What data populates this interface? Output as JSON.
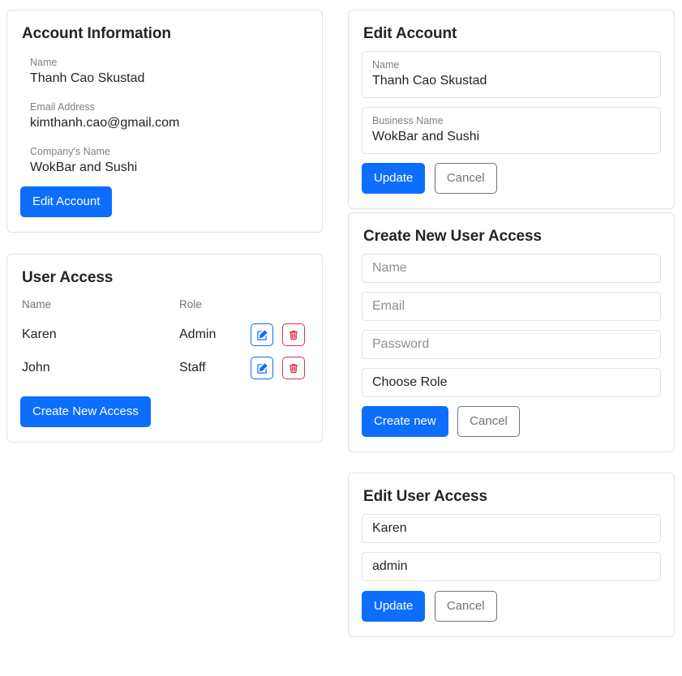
{
  "account_information": {
    "title": "Account Information",
    "fields": [
      {
        "label": "Name",
        "value": "Thanh Cao Skustad"
      },
      {
        "label": "Email Address",
        "value": "kimthanh.cao@gmail.com"
      },
      {
        "label": "Company's Name",
        "value": "WokBar and Sushi"
      }
    ],
    "edit_button": "Edit Account"
  },
  "user_access": {
    "title": "User Access",
    "columns": [
      "Name",
      "Role"
    ],
    "rows": [
      {
        "name": "Karen",
        "role": "Admin",
        "edit_icon": "pen-to-square-icon",
        "delete_icon": "trash-icon"
      },
      {
        "name": "John",
        "role": "Staff",
        "edit_icon": "pen-to-square-icon",
        "delete_icon": "trash-icon"
      }
    ],
    "create_button": "Create New Access"
  },
  "edit_account": {
    "title": "Edit Account",
    "fields": [
      {
        "label": "Name",
        "value": "Thanh Cao Skustad"
      },
      {
        "label": "Business Name",
        "value": "WokBar and Sushi"
      }
    ],
    "update_button": "Update",
    "cancel_button": "Cancel"
  },
  "create_user_access": {
    "title": "Create New User Access",
    "name_placeholder": "Name",
    "email_placeholder": "Email",
    "password_placeholder": "Password",
    "role_selected": "Choose Role",
    "create_button": "Create new",
    "cancel_button": "Cancel"
  },
  "edit_user_access": {
    "title": "Edit User Access",
    "name_value": "Karen",
    "role_value": "admin",
    "update_button": "Update",
    "cancel_button": "Cancel"
  },
  "colors": {
    "primary": "#0d6efd",
    "danger": "#dc3545",
    "secondary": "#6c757d",
    "border": "#dfe1e4",
    "text": "#212529",
    "muted": "#7b8087"
  }
}
